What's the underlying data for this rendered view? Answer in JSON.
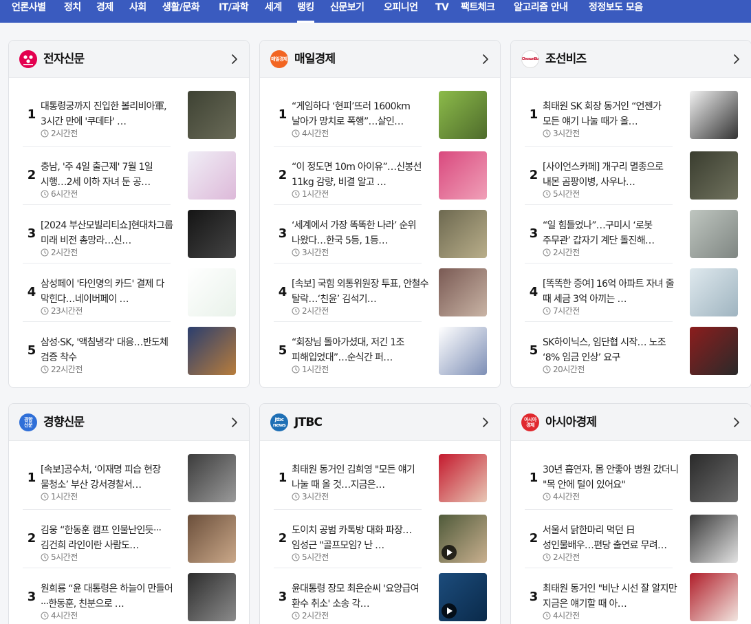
{
  "nav": {
    "items": [
      "언론사별",
      "정치",
      "경제",
      "사회",
      "생활/문화",
      "IT/과학",
      "세계",
      "랭킹",
      "신문보기",
      "오피니언",
      "TV",
      "팩트체크",
      "알고리즘 안내",
      "정정보도 모음"
    ],
    "active": "랭킹"
  },
  "cards": [
    {
      "name": "전자신문",
      "logo_text": "",
      "logo_color": "#e3004f",
      "items": [
        {
          "rank": "1",
          "title": "대통령궁까지 진입한 볼리비아軍, 3시간 만에 '쿠데타' …",
          "time": "2시간전",
          "thumb": [
            "#3e4233",
            "#6a6b58"
          ]
        },
        {
          "rank": "2",
          "title": "충남, '주 4일 출근제' 7월 1일 시행…2세 이하 자녀 둔 공…",
          "time": "6시간전",
          "thumb": [
            "#f0eef6",
            "#ddb9d9"
          ]
        },
        {
          "rank": "3",
          "title": "[2024 부산모빌리티쇼]현대차그룹 미래 비전 총망라…신…",
          "time": "2시간전",
          "thumb": [
            "#151515",
            "#444"
          ]
        },
        {
          "rank": "4",
          "title": "삼성페이 '타인명의 카드' 결제 다 막힌다…네이버페이 …",
          "time": "23시간전",
          "thumb": [
            "#ffffff",
            "#e9f2ea"
          ]
        },
        {
          "rank": "5",
          "title": "삼성·SK, '액침냉각' 대응…반도체 검증 착수",
          "time": "22시간전",
          "thumb": [
            "#2b3e6e",
            "#b87d3c"
          ]
        }
      ]
    },
    {
      "name": "매일경제",
      "logo_text": "매일경제",
      "logo_color": "#f26522",
      "items": [
        {
          "rank": "1",
          "title": "“게임하다 ‘현피’뜨러 1600km 날아가 망치로 폭행”…살인…",
          "time": "4시간전",
          "thumb": [
            "#8cbb4a",
            "#4e6b2b"
          ]
        },
        {
          "rank": "2",
          "title": "“이 정도면 10m 아이유”…신봉선 11kg 감량, 비결 알고 …",
          "time": "1시간전",
          "thumb": [
            "#d9497e",
            "#f0a0b8"
          ]
        },
        {
          "rank": "3",
          "title": "‘세계에서 가장 똑똑한 나라’ 순위 나왔다…한국 5등, 1등…",
          "time": "3시간전",
          "thumb": [
            "#6d6950",
            "#b9ae8a"
          ]
        },
        {
          "rank": "4",
          "title": "[속보] 국힘 외통위원장 투표, 안철수 탈락…‘친윤’ 김석기…",
          "time": "2시간전",
          "thumb": [
            "#7a5a54",
            "#c9b4a5"
          ]
        },
        {
          "rank": "5",
          "title": "“회장님 돌아가셨대, 저긴 1조 피해입었대”…순식간 퍼…",
          "time": "1시간전",
          "thumb": [
            "#ffffff",
            "#7e8fb6"
          ]
        }
      ]
    },
    {
      "name": "조선비즈",
      "logo_text": "ChosunBiz",
      "logo_color": "#ffffff",
      "items": [
        {
          "rank": "1",
          "title": "최태원 SK 회장 동거인 “언젠가 모든 얘기 나눌 때가 올…",
          "time": "3시간전",
          "thumb": [
            "#f1f1f1",
            "#333"
          ]
        },
        {
          "rank": "2",
          "title": "[사이언스카페] 개구리 멸종으로 내몬 곰팡이병, 사우나…",
          "time": "5시간전",
          "thumb": [
            "#3a3d2f",
            "#70725e"
          ]
        },
        {
          "rank": "3",
          "title": "“일 힘들었나”…구미시 ‘로봇 주무관’ 갑자기 계단 돌진해…",
          "time": "2시간전",
          "thumb": [
            "#bfc6c0",
            "#7f8682"
          ]
        },
        {
          "rank": "4",
          "title": "[똑똑한 증여] 16억 아파트 자녀 줄 때 세금 3억 아끼는 …",
          "time": "7시간전",
          "thumb": [
            "#dfe9ee",
            "#9fb4c0"
          ]
        },
        {
          "rank": "5",
          "title": "SK하이닉스, 임단협 시작… 노조 ‘8% 임금 인상’ 요구",
          "time": "20시간전",
          "thumb": [
            "#8c1d1d",
            "#2a2a2a"
          ]
        }
      ]
    },
    {
      "name": "경향신문",
      "logo_text": "경향\n신문",
      "logo_color": "#2f6fd8",
      "items": [
        {
          "rank": "1",
          "title": "[속보]공수처, ‘이재명 피습 현장 물청소’ 부산 강서경찰서…",
          "time": "1시간전",
          "thumb": [
            "#3c3c3c",
            "#9a9a9a"
          ]
        },
        {
          "rank": "2",
          "title": "김웅 “한동훈 캠프 인물난인듯···김건희 라인이란 사람도…",
          "time": "5시간전",
          "thumb": [
            "#6b4f3b",
            "#caa889"
          ]
        },
        {
          "rank": "3",
          "title": "원희룡 “윤 대통령은 하늘이 만들어···한동훈, 친분으로 …",
          "time": "4시간전",
          "thumb": [
            "#2d2d2d",
            "#8b8b8b"
          ]
        }
      ]
    },
    {
      "name": "JTBC",
      "logo_text": "jtbc\nnews",
      "logo_color": "#1e6fb5",
      "items": [
        {
          "rank": "1",
          "title": "최태원 동거인 김희영 \"모든 얘기 나눌 때 올 것…지금은…",
          "time": "3시간전",
          "thumb": [
            "#c41a2e",
            "#e8c7b5"
          ]
        },
        {
          "rank": "2",
          "title": "도이치 공범 카톡방 대화 파장…임성근 \"골프모임? 난 …",
          "time": "5시간전",
          "thumb": [
            "#4f5a3a",
            "#c9b08f"
          ],
          "video": true
        },
        {
          "rank": "3",
          "title": "윤대통령 장모 최은순씨 '요양급여 환수 취소' 소송 각…",
          "time": "2시간전",
          "thumb": [
            "#1c4c7c",
            "#0a2a4a"
          ],
          "video": true
        }
      ]
    },
    {
      "name": "아시아경제",
      "logo_text": "아시아\n경제",
      "logo_color": "#e0282e",
      "items": [
        {
          "rank": "1",
          "title": "30년 흡연자, 몸 안좋아 병원 갔더니 \"목 안에 털이 있어요\"",
          "time": "4시간전",
          "thumb": [
            "#2a2a2a",
            "#6d6d6d"
          ]
        },
        {
          "rank": "2",
          "title": "서울서 닭한마리 먹던 日 성인물배우…편당 출연료 무려…",
          "time": "2시간전",
          "thumb": [
            "#3a3a3a",
            "#e2e2e2"
          ]
        },
        {
          "rank": "3",
          "title": "최태원 동거인 \"비난 시선 잘 알지만 지금은 얘기할 때 아…",
          "time": "4시간전",
          "thumb": [
            "#b01e2a",
            "#f2e6e0"
          ]
        }
      ]
    }
  ]
}
